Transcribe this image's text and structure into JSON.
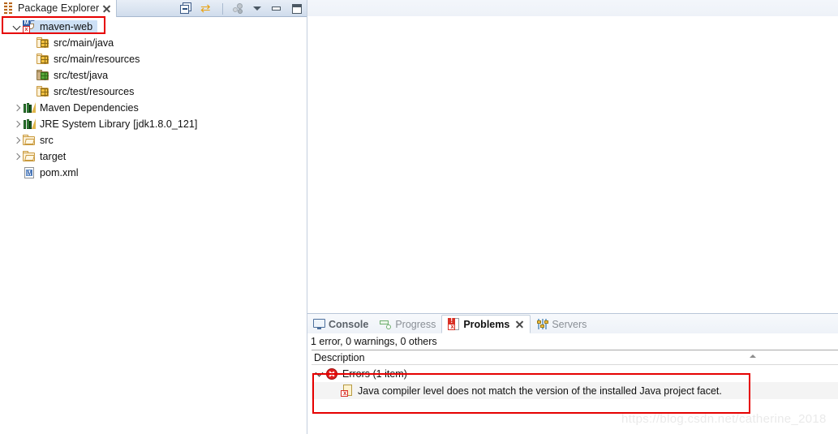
{
  "explorer": {
    "view_icon": "package-explorer-icon",
    "tab_title": "Package Explorer",
    "close_icon": "close-icon",
    "toolbar": [
      {
        "name": "collapse-all-icon",
        "label": "Collapse All"
      },
      {
        "name": "link-with-editor-icon",
        "label": "Link with Editor"
      },
      {
        "name": "focus-on-active-task-icon",
        "label": "Focus on Active Task"
      },
      {
        "name": "view-menu-icon",
        "label": "View Menu"
      },
      {
        "name": "minimize-icon",
        "label": "Minimize"
      },
      {
        "name": "maximize-icon",
        "label": "Maximize"
      }
    ],
    "tree": [
      {
        "label": "maven-web",
        "icon": "maven-project-icon",
        "twisty": "down",
        "indent": 0,
        "selected": true,
        "suffix": ""
      },
      {
        "label": "src/main/java",
        "icon": "source-folder-icon",
        "twisty": "none",
        "indent": 1,
        "selected": false,
        "suffix": ""
      },
      {
        "label": "src/main/resources",
        "icon": "source-folder-icon",
        "twisty": "none",
        "indent": 1,
        "selected": false,
        "suffix": ""
      },
      {
        "label": "src/test/java",
        "icon": "source-folder-green-icon",
        "twisty": "none",
        "indent": 1,
        "selected": false,
        "suffix": ""
      },
      {
        "label": "src/test/resources",
        "icon": "source-folder-icon",
        "twisty": "none",
        "indent": 1,
        "selected": false,
        "suffix": ""
      },
      {
        "label": "Maven Dependencies",
        "icon": "library-icon",
        "twisty": "right",
        "indent": 0,
        "selected": false,
        "suffix": ""
      },
      {
        "label": "JRE System Library",
        "icon": "library-icon",
        "twisty": "right",
        "indent": 0,
        "selected": false,
        "suffix": "[jdk1.8.0_121]"
      },
      {
        "label": "src",
        "icon": "folder-icon",
        "twisty": "right",
        "indent": 0,
        "selected": false,
        "suffix": ""
      },
      {
        "label": "target",
        "icon": "folder-icon",
        "twisty": "right",
        "indent": 0,
        "selected": false,
        "suffix": ""
      },
      {
        "label": "pom.xml",
        "icon": "xml-file-icon",
        "twisty": "none",
        "indent": 0,
        "selected": false,
        "suffix": ""
      }
    ]
  },
  "bottom_panel": {
    "tabs": [
      {
        "label": "Console",
        "icon": "console-icon",
        "active": false,
        "bold": true,
        "closable": false
      },
      {
        "label": "Progress",
        "icon": "progress-icon",
        "active": false,
        "bold": false,
        "closable": false
      },
      {
        "label": "Problems",
        "icon": "problems-icon",
        "active": true,
        "bold": true,
        "closable": true
      },
      {
        "label": "Servers",
        "icon": "servers-icon",
        "active": false,
        "bold": false,
        "closable": false
      }
    ],
    "summary": "1 error, 0 warnings, 0 others",
    "column_header": "Description",
    "sort_indicator": "sort-ascending-icon",
    "rows": [
      {
        "label": "Errors (1 item)",
        "icon": "error-circle-icon",
        "level": 0,
        "twisty": "down"
      },
      {
        "label": "Java compiler level does not match the version of the installed Java project facet.",
        "icon": "problem-marker-icon",
        "level": 1,
        "twisty": "none"
      }
    ]
  },
  "annotations": {
    "highlight_color": "#e60000",
    "watermark": "https://blog.csdn.net/catherine_2018"
  }
}
